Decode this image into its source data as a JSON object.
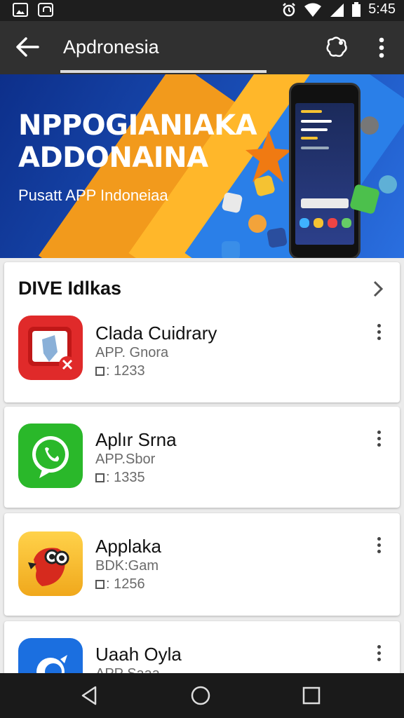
{
  "status_bar": {
    "time": "5:45",
    "icons": [
      "gallery-icon",
      "bag-icon",
      "alarm-icon",
      "wifi-icon",
      "signal-icon",
      "battery-icon"
    ]
  },
  "app_bar": {
    "title": "Apdronesia",
    "icons": [
      "back-arrow-icon",
      "share-icon",
      "overflow-menu-icon"
    ]
  },
  "banner": {
    "headline_line1": "NPPOGIANIAKA",
    "headline_line2": "ADDONAINA",
    "subtitle": "Pusatt APP Indoneiaa",
    "accent_colors": [
      "#f29a1c",
      "#ffb72a",
      "#1a4fb8"
    ]
  },
  "section": {
    "title": "DIVE Idlkas",
    "chevron_icon": "chevron-right-icon"
  },
  "apps": [
    {
      "name": "Clada Cuidrary",
      "category": "APP. Gnora",
      "stat": "1233",
      "icon": "red-tablet-app-icon",
      "color": "#e02a2a"
    },
    {
      "name": "Aplır Srna",
      "category": "APP.Sbor",
      "stat": "1335",
      "icon": "green-chat-app-icon",
      "color": "#2ab82a"
    },
    {
      "name": "Applaka",
      "category": "BDK:Gam",
      "stat": "1256",
      "icon": "yellow-bird-app-icon",
      "color": "#f2b81f"
    },
    {
      "name": "Uaah Oyla",
      "category": "APP Saaa",
      "stat": "",
      "icon": "blue-app-icon",
      "color": "#1b6fe0"
    }
  ],
  "stat_prefix": "□: ",
  "nav_bar": {
    "icons": [
      "back-triangle-icon",
      "home-circle-icon",
      "recents-square-icon"
    ]
  }
}
